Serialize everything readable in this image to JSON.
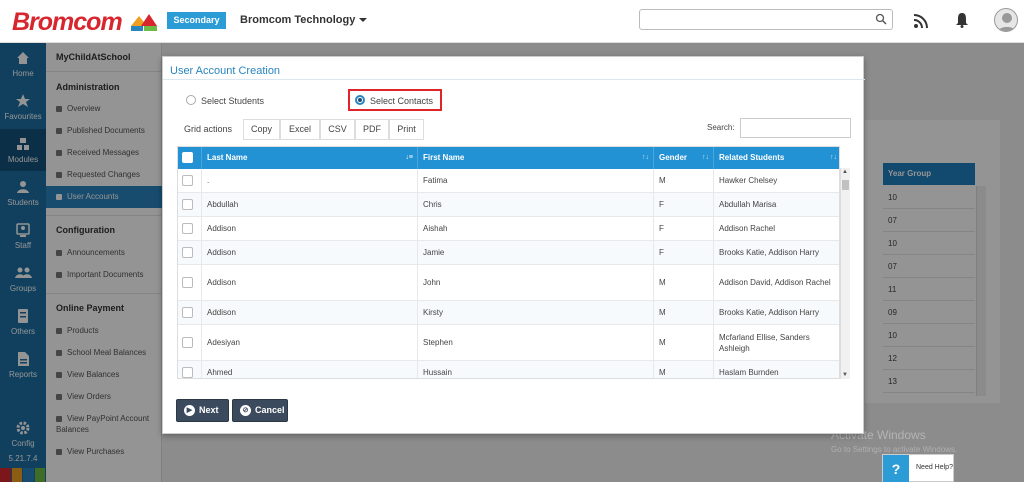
{
  "header": {
    "logo_text": "Bromcom",
    "env_badge": "Secondary",
    "org_name": "Bromcom Technology",
    "icons": [
      "rss-icon",
      "bell-icon",
      "user-avatar"
    ]
  },
  "leftnav": {
    "items": [
      {
        "label": "Home",
        "icon": "home-icon"
      },
      {
        "label": "Favourites",
        "icon": "star-icon"
      },
      {
        "label": "Modules",
        "icon": "modules-icon"
      },
      {
        "label": "Students",
        "icon": "student-icon"
      },
      {
        "label": "Staff",
        "icon": "staff-icon"
      },
      {
        "label": "Groups",
        "icon": "groups-icon"
      },
      {
        "label": "Others",
        "icon": "others-icon"
      },
      {
        "label": "Reports",
        "icon": "reports-icon"
      },
      {
        "label": "Config",
        "icon": "gear-icon"
      }
    ],
    "version": "5.21.7.4",
    "strip_colors": [
      "#d8262e",
      "#f0a020",
      "#2a84bd",
      "#6dba44",
      "#d8262e",
      "#2a84bd"
    ]
  },
  "subnav": {
    "app_title": "MyChildAtSchool",
    "sections": {
      "administration": "Administration",
      "configuration": "Configuration",
      "online_payment": "Online Payment"
    },
    "admin_items": [
      "Overview",
      "Published Documents",
      "Received Messages",
      "Requested Changes",
      "User Accounts"
    ],
    "config_items": [
      "Announcements",
      "Important Documents"
    ],
    "payment_items": [
      "Products",
      "School Meal Balances",
      "View Balances",
      "View Orders",
      "View PayPoint Account Balances",
      "View Purchases"
    ]
  },
  "background": {
    "column_header": "Year Group",
    "values": [
      "10",
      "07",
      "10",
      "07",
      "11",
      "09",
      "10",
      "12",
      "13"
    ],
    "watermark_title": "Activate Windows",
    "watermark_sub": "Go to Settings to activate Windows.",
    "help_label": "Need Help?"
  },
  "modal": {
    "title": "User Account Creation",
    "radio_students": "Select Students",
    "radio_contacts": "Select Contacts",
    "selected_radio": "contacts",
    "grid_actions_label": "Grid actions",
    "grid_buttons": [
      "Copy",
      "Excel",
      "CSV",
      "PDF",
      "Print"
    ],
    "search_label": "Search:",
    "search_value": "",
    "columns": [
      "Last Name",
      "First Name",
      "Gender",
      "Related Students"
    ],
    "rows": [
      {
        "last": ".",
        "first": "Fatima",
        "gender": "M",
        "related": "Hawker Chelsey"
      },
      {
        "last": "Abdullah",
        "first": "Chris",
        "gender": "F",
        "related": "Abdullah Marisa"
      },
      {
        "last": "Addison",
        "first": "Aishah",
        "gender": "F",
        "related": "Addison Rachel"
      },
      {
        "last": "Addison",
        "first": "Jamie",
        "gender": "F",
        "related": "Brooks Katie, Addison Harry"
      },
      {
        "last": "Addison",
        "first": "John",
        "gender": "M",
        "related": "Addison David, Addison Rachel"
      },
      {
        "last": "Addison",
        "first": "Kirsty",
        "gender": "M",
        "related": "Brooks Katie, Addison Harry"
      },
      {
        "last": "Adesiyan",
        "first": "Stephen",
        "gender": "M",
        "related": "Mcfarland Ellise, Sanders Ashleigh"
      },
      {
        "last": "Ahmed",
        "first": "Hussain",
        "gender": "M",
        "related": "Haslam Burnden"
      }
    ],
    "next_label": "Next",
    "cancel_label": "Cancel"
  }
}
